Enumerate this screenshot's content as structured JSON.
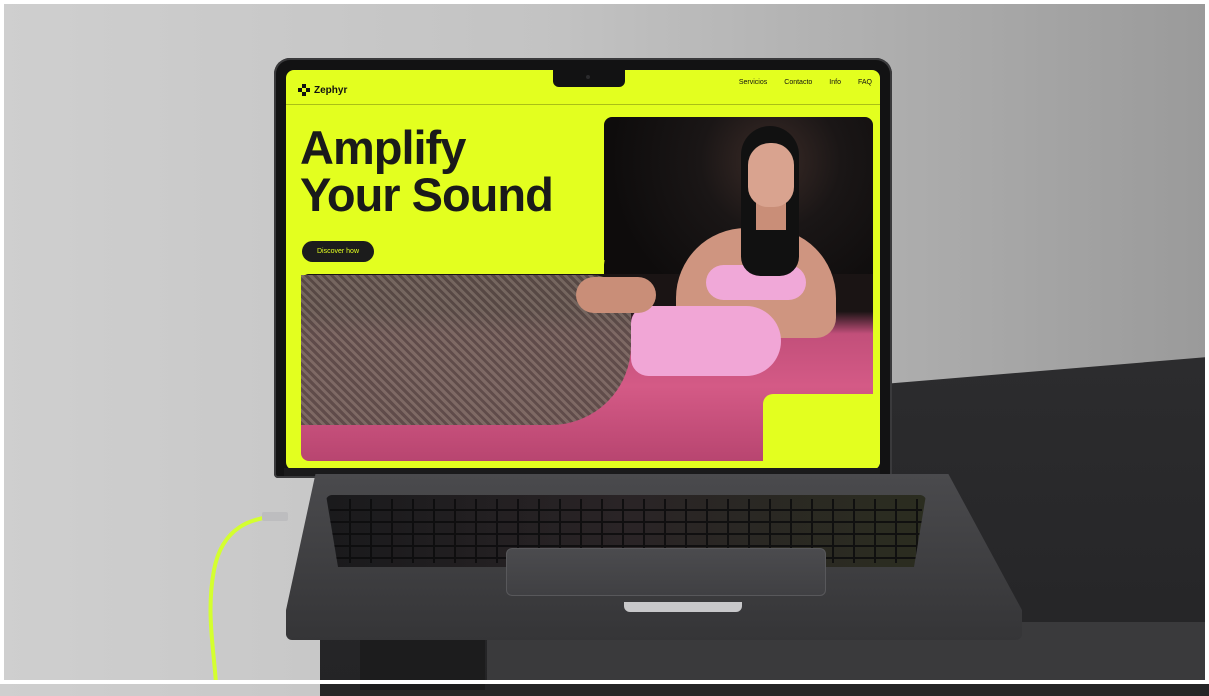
{
  "site": {
    "logo_text": "Zephyr",
    "nav": [
      "Servicios",
      "Contacto",
      "Info",
      "FAQ"
    ],
    "hero_line1": "Amplify",
    "hero_line2": "Your Sound",
    "cta_label": "Discover how"
  },
  "colors": {
    "accent": "#e3ff1f",
    "dark": "#1a1a1a",
    "pink_surface": "#d45a86",
    "cable": "#d4ff2f"
  },
  "icons": [
    "zephyr-logo-icon"
  ]
}
